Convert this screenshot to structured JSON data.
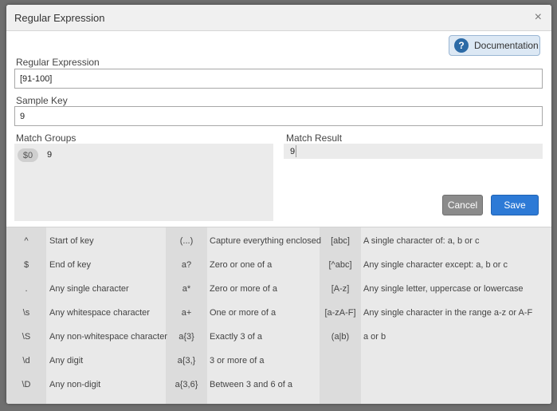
{
  "dialog": {
    "title": "Regular Expression",
    "close_symbol": "×",
    "documentation_label": "Documentation",
    "documentation_icon": "?"
  },
  "fields": {
    "regex_label": "Regular Expression",
    "regex_value": "[91-100]",
    "sample_key_label": "Sample Key",
    "sample_key_value": "9"
  },
  "match_groups": {
    "label": "Match Groups",
    "items": [
      {
        "tag": "$0",
        "value": "9"
      }
    ]
  },
  "match_result": {
    "label": "Match Result",
    "value": "9"
  },
  "buttons": {
    "cancel": "Cancel",
    "save": "Save"
  },
  "reference": {
    "col1": [
      {
        "symbol": "^",
        "desc": "Start of key"
      },
      {
        "symbol": "$",
        "desc": "End of key"
      },
      {
        "symbol": ".",
        "desc": "Any single character"
      },
      {
        "symbol": "\\s",
        "desc": "Any whitespace character"
      },
      {
        "symbol": "\\S",
        "desc": "Any non-whitespace character"
      },
      {
        "symbol": "\\d",
        "desc": "Any digit"
      },
      {
        "symbol": "\\D",
        "desc": "Any non-digit"
      }
    ],
    "col2": [
      {
        "symbol": "(...)",
        "desc": "Capture everything enclosed"
      },
      {
        "symbol": "a?",
        "desc": "Zero or one of a"
      },
      {
        "symbol": "a*",
        "desc": "Zero or more of a"
      },
      {
        "symbol": "a+",
        "desc": "One or more of a"
      },
      {
        "symbol": "a{3}",
        "desc": "Exactly 3 of a"
      },
      {
        "symbol": "a{3,}",
        "desc": "3 or more of a"
      },
      {
        "symbol": "a{3,6}",
        "desc": "Between 3 and 6 of a"
      }
    ],
    "col3": [
      {
        "symbol": "[abc]",
        "desc": "A single character of: a, b or c"
      },
      {
        "symbol": "[^abc]",
        "desc": "Any single character except: a, b or c"
      },
      {
        "symbol": "[A-z]",
        "desc": "Any single letter, uppercase or lowercase"
      },
      {
        "symbol": "[a-zA-F]",
        "desc": "Any single character in the range a-z or A-F"
      },
      {
        "symbol": "(a|b)",
        "desc": "a or b"
      }
    ]
  }
}
